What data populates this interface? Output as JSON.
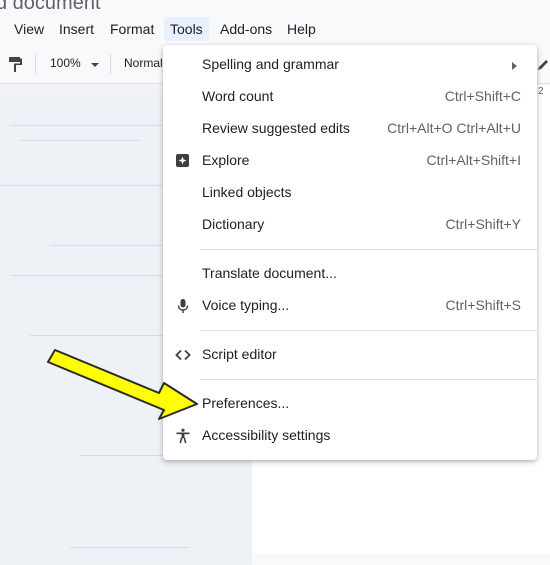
{
  "window": {
    "title_fragment": "d document"
  },
  "menubar": [
    "View",
    "Insert",
    "Format",
    "Tools",
    "Add-ons",
    "Help"
  ],
  "active_menu": "Tools",
  "toolbar": {
    "zoom": "100%",
    "style": "Normal",
    "ruler_number": "2"
  },
  "tools_menu": {
    "items": [
      {
        "label": "Spelling and grammar",
        "shortcut": "",
        "icon": "",
        "submenu": true
      },
      {
        "label": "Word count",
        "shortcut": "Ctrl+Shift+C",
        "icon": ""
      },
      {
        "label": "Review suggested edits",
        "shortcut": "Ctrl+Alt+O Ctrl+Alt+U",
        "icon": ""
      },
      {
        "label": "Explore",
        "shortcut": "Ctrl+Alt+Shift+I",
        "icon": "explore-icon"
      },
      {
        "label": "Linked objects",
        "shortcut": "",
        "icon": ""
      },
      {
        "label": "Dictionary",
        "shortcut": "Ctrl+Shift+Y",
        "icon": ""
      },
      {
        "label": "Translate document...",
        "shortcut": "",
        "icon": ""
      },
      {
        "label": "Voice typing...",
        "shortcut": "Ctrl+Shift+S",
        "icon": "microphone-icon"
      },
      {
        "label": "Script editor",
        "shortcut": "",
        "icon": "code-icon"
      },
      {
        "label": "Preferences...",
        "shortcut": "",
        "icon": ""
      },
      {
        "label": "Accessibility settings",
        "shortcut": "",
        "icon": "accessibility-icon"
      }
    ]
  },
  "annotation": {
    "arrow_color": "#ffff00",
    "arrow_outline": "#2b2b2b",
    "points_to": "Preferences..."
  },
  "colors": {
    "menu_active_bg": "#e8f0fe",
    "text": "#202124",
    "shortcut": "#5f6368"
  }
}
